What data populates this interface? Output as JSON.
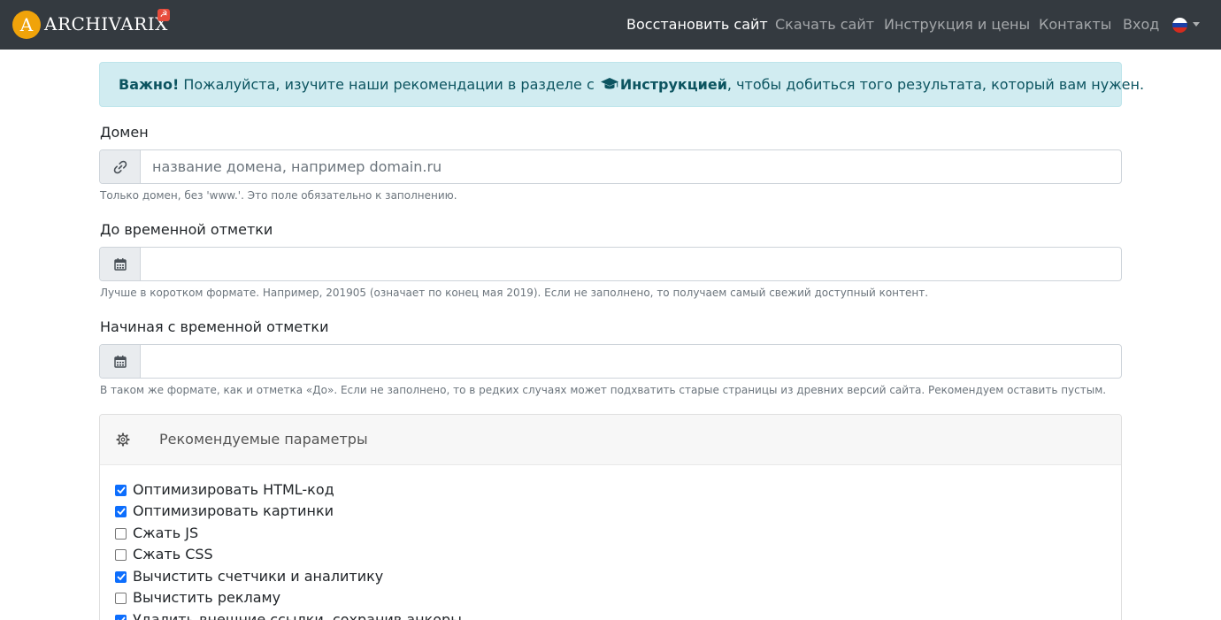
{
  "brand": {
    "logo_letter": "A",
    "name": "ARCHIVARIX",
    "badge": "☭"
  },
  "nav": {
    "items": [
      {
        "label": "Восстановить сайт",
        "active": true
      },
      {
        "label": "Скачать сайт",
        "active": false
      },
      {
        "label": "Инструкция и цены",
        "active": false
      },
      {
        "label": "Контакты",
        "active": false
      },
      {
        "label": "Вход",
        "active": false
      }
    ],
    "language_flag": "ru"
  },
  "alert": {
    "strong": "Важно!",
    "text_before": " Пожалуйста, изучите наши рекомендации в разделе с ",
    "link_text": "Инструкцией",
    "text_after": ", чтобы добиться того результата, который вам нужен."
  },
  "form": {
    "domain": {
      "label": "Домен",
      "placeholder": "название домена, например domain.ru",
      "value": "",
      "help": "Только домен, без 'www.'. Это поле обязательно к заполнению."
    },
    "to_timestamp": {
      "label": "До временной отметки",
      "value": "",
      "help": "Лучше в коротком формате. Например, 201905 (означает по конец мая 2019). Если не заполнено, то получаем самый свежий доступный контент."
    },
    "from_timestamp": {
      "label": "Начиная с временной отметки",
      "value": "",
      "help": "В таком же формате, как и отметка «До». Если не заполнено, то в редких случаях может подхватить старые страницы из древних версий сайта. Рекомендуем оставить пустым."
    }
  },
  "recommended": {
    "title": "Рекомендуемые параметры",
    "options": [
      {
        "label": "Оптимизировать HTML-код",
        "checked": true
      },
      {
        "label": "Оптимизировать картинки",
        "checked": true
      },
      {
        "label": "Сжать JS",
        "checked": false
      },
      {
        "label": "Сжать CSS",
        "checked": false
      },
      {
        "label": "Вычистить счетчики и аналитику",
        "checked": true
      },
      {
        "label": "Вычистить рекламу",
        "checked": false
      },
      {
        "label": "Удалить внешние ссылки, сохранив анкоры",
        "checked": true
      }
    ]
  },
  "colors": {
    "navbar": "#343a40",
    "alert_bg": "#d1ecf1",
    "alert_text": "#0c5460",
    "accent": "#0d6efd",
    "logo": "#f0a30a"
  }
}
